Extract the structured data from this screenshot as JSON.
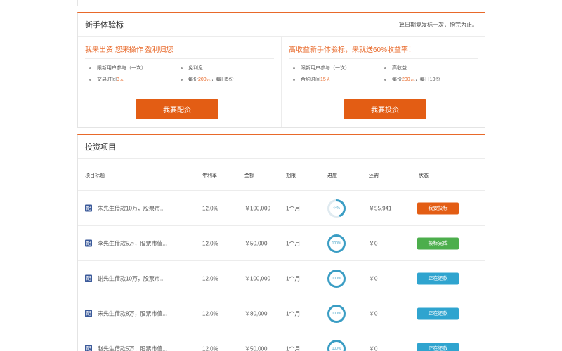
{
  "novice": {
    "title": "新手体验标",
    "note": "算日期复发标一次，抢完为止。",
    "left": {
      "title": "我来出资 您来操作 盈利归您",
      "features": [
        {
          "pre": "限新用户参与（一次）",
          "hl": "",
          "post": ""
        },
        {
          "pre": "免利息",
          "hl": "",
          "post": ""
        },
        {
          "pre": "交易时间",
          "hl": "3天",
          "post": ""
        },
        {
          "pre": "每份",
          "hl": "200元",
          "post": "，每日5份"
        }
      ],
      "button": "我要配资"
    },
    "right": {
      "title": "高收益新手体验标，来就送60%收益率！",
      "features": [
        {
          "pre": "限新用户参与（一次）",
          "hl": "",
          "post": ""
        },
        {
          "pre": "高收益",
          "hl": "",
          "post": ""
        },
        {
          "pre": "合约时间",
          "hl": "15天",
          "post": ""
        },
        {
          "pre": "每份",
          "hl": "200元",
          "post": "，每日10份"
        }
      ],
      "button": "我要投资"
    }
  },
  "projects": {
    "title": "投资项目",
    "headers": {
      "title": "项目标题",
      "rate": "年利率",
      "amount": "金额",
      "term": "期限",
      "progress": "进度",
      "repaid": "还需",
      "status": "状态"
    },
    "icon_label": "配",
    "rows": [
      {
        "title": "朱先生借款10万，股票市...",
        "rate": "12.0%",
        "amount": "￥100,000",
        "term": "1个月",
        "progress": 0.44,
        "progress_label": "44%",
        "repaid": "￥55,941",
        "status": "我要投标",
        "status_color": "#e35d14"
      },
      {
        "title": "李先生借款5万，股票市值...",
        "rate": "12.0%",
        "amount": "￥50,000",
        "term": "1个月",
        "progress": 1.0,
        "progress_label": "100%",
        "repaid": "￥0",
        "status": "投标完成",
        "status_color": "#4cae4c"
      },
      {
        "title": "谢先生借款10万，股票市...",
        "rate": "12.0%",
        "amount": "￥100,000",
        "term": "1个月",
        "progress": 1.0,
        "progress_label": "100%",
        "repaid": "￥0",
        "status": "正在还款",
        "status_color": "#2fa4cf"
      },
      {
        "title": "宋先生借款8万，股票市值...",
        "rate": "12.0%",
        "amount": "￥80,000",
        "term": "1个月",
        "progress": 1.0,
        "progress_label": "100%",
        "repaid": "￥0",
        "status": "正在还款",
        "status_color": "#2fa4cf"
      },
      {
        "title": "赵先生借款5万，股票市值...",
        "rate": "12.0%",
        "amount": "￥50,000",
        "term": "1个月",
        "progress": 1.0,
        "progress_label": "100%",
        "repaid": "￥0",
        "status": "正在还款",
        "status_color": "#2fa4cf"
      }
    ]
  },
  "colors": {
    "accent": "#e8692a",
    "ring": "#3a9dc4",
    "ring_track": "#dfeaf0"
  }
}
